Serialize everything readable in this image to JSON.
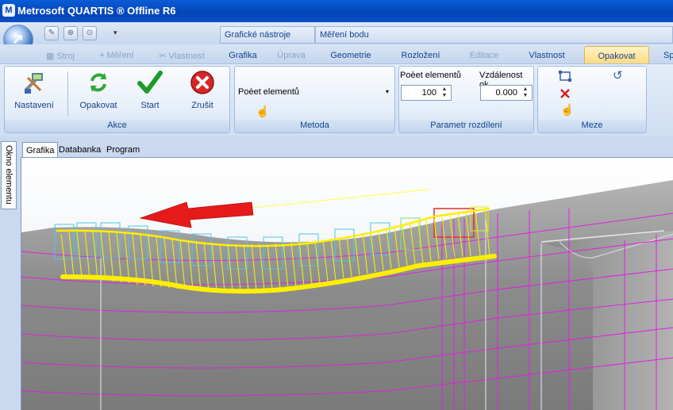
{
  "window": {
    "title": "Metrosoft QUARTIS ® Offline R6"
  },
  "context_headers": {
    "graphics_tools": "Grafické nástroje",
    "point_measurement": "Měření bodu"
  },
  "tabs": {
    "stroj": "Stroj",
    "mereni": "Měření",
    "vlastnost_left": "Vlastnost",
    "grafika": "Grafika",
    "uprava": "Úprava",
    "geometrie": "Geometrie",
    "rozlozeni": "Rozložení",
    "editace": "Editace",
    "vlastnost": "Vlastnost",
    "opakovat": "Opakovat",
    "sp": "Sp"
  },
  "groups": {
    "akce": {
      "label": "Akce",
      "nastaveni": "Nastavení",
      "opakovat": "Opakovat",
      "start": "Start",
      "zrusit": "Zrušit"
    },
    "metoda": {
      "label": "Metoda",
      "dropdown_value": "Poèet elementů"
    },
    "parametr": {
      "label": "Parametr rozdílení",
      "count_label": "Poèet elementů",
      "count_value": "100",
      "distance_label": "Vzdálenost ok",
      "distance_value": "0.000"
    },
    "meze": {
      "label": "Meze"
    }
  },
  "side_panel": {
    "label": "Okno elementu"
  },
  "doc_tabs": [
    "Grafika",
    "Databanka",
    "Program"
  ],
  "colors": {
    "ribbon_active_tab": "#ffd87a",
    "mesh_magenta": "#e020e0",
    "selection_yellow": "#ffff00",
    "arrow_red": "#e61a1a",
    "surface_gray": "#8f8f8f"
  }
}
